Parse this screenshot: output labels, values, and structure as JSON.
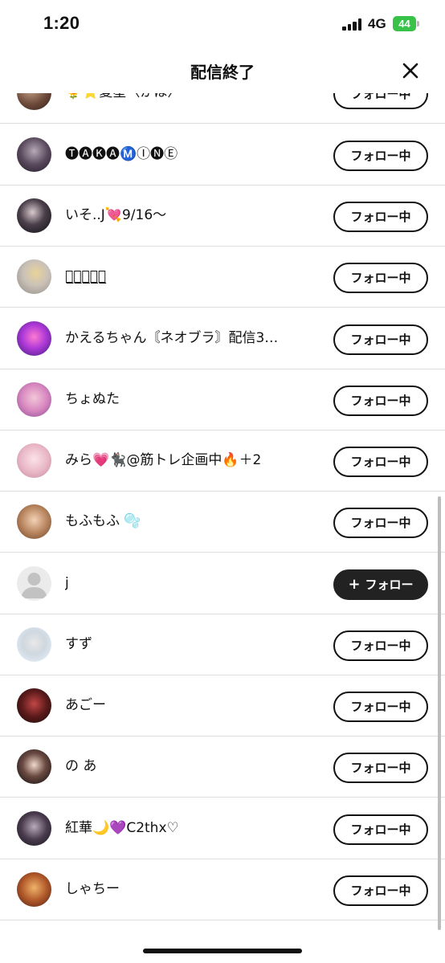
{
  "status_bar": {
    "time": "1:20",
    "network": "4G",
    "battery": "44"
  },
  "header": {
    "title": "配信終了",
    "close_icon": "close-icon"
  },
  "colors": {
    "follow_button_bg": "#222222",
    "following_border": "#111111",
    "battery_green": "#38c24a"
  },
  "users": [
    {
      "name": "🌻⭐️夏星〈かほ〉",
      "button": "フォロー中",
      "following": true
    },
    {
      "name": "🅣🅐🅚🅐Ⓜ️Ⓘ🅝Ⓔ",
      "button": "フォロー中",
      "following": true
    },
    {
      "name": "いそ..J💘9/16〜",
      "button": "フォロー中",
      "following": true
    },
    {
      "name": "か̲む̲ゅ̲ゅ̲ゅ̲",
      "button": "フォロー中",
      "following": true
    },
    {
      "name": "かえるちゃん〘ネオブラ〙配信3…",
      "button": "フォロー中",
      "following": true
    },
    {
      "name": "ちょぬた",
      "button": "フォロー中",
      "following": true
    },
    {
      "name": "みら💗🐈‍⬛@筋トレ企画中🔥＋2",
      "button": "フォロー中",
      "following": true
    },
    {
      "name": "もふもふ 🫧",
      "button": "フォロー中",
      "following": true
    },
    {
      "name": "j",
      "button": "フォロー",
      "following": false
    },
    {
      "name": "すず",
      "button": "フォロー中",
      "following": true
    },
    {
      "name": "あごー",
      "button": "フォロー中",
      "following": true
    },
    {
      "name": "の あ",
      "button": "フォロー中",
      "following": true
    },
    {
      "name": "紅華🌙💜C2thx♡",
      "button": "フォロー中",
      "following": true
    },
    {
      "name": "しゃちー",
      "button": "フォロー中",
      "following": true
    }
  ]
}
